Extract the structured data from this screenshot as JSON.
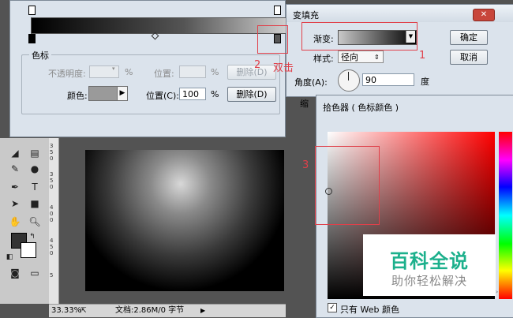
{
  "workspace": {
    "zoom": "33.33%",
    "doc_info": "文档:2.86M/0 字节",
    "ruler_numbers": [
      "3",
      "5",
      "0",
      "3",
      "5",
      "0",
      "4",
      "0",
      "0",
      "4",
      "5",
      "0",
      "5"
    ]
  },
  "gradient_editor": {
    "section_title": "色标",
    "opacity_label": "不透明度:",
    "opacity_unit": "%",
    "opacity_location_label": "位置:",
    "opacity_location_unit": "%",
    "opacity_delete_label": "删除(D)",
    "color_label": "颜色:",
    "color_location_label": "位置(C):",
    "color_location_value": "100",
    "color_location_unit": "%",
    "color_delete_label": "删除(D)"
  },
  "gradient_fill": {
    "title": "变填充",
    "gradient_label": "渐变:",
    "ok_label": "确定",
    "cancel_label": "取消",
    "style_label": "样式:",
    "style_value": "径向",
    "angle_label": "角度(A):",
    "angle_value": "90",
    "angle_unit": "度",
    "scale_label": "缩"
  },
  "color_picker": {
    "title": "拾色器 ( 色标颜色 )",
    "web_only_label": "只有 Web 颜色"
  },
  "watermark": {
    "title": "百科全说",
    "subtitle": "助你轻松解决"
  },
  "annotations": {
    "label_1": "1",
    "label_2": "2",
    "label_2_note": "双击",
    "label_3": "3"
  },
  "colors": {
    "annotation_red": "#e0404a",
    "watermark_green": "#1cb08c",
    "dialog_bg": "#dbe3ec"
  }
}
